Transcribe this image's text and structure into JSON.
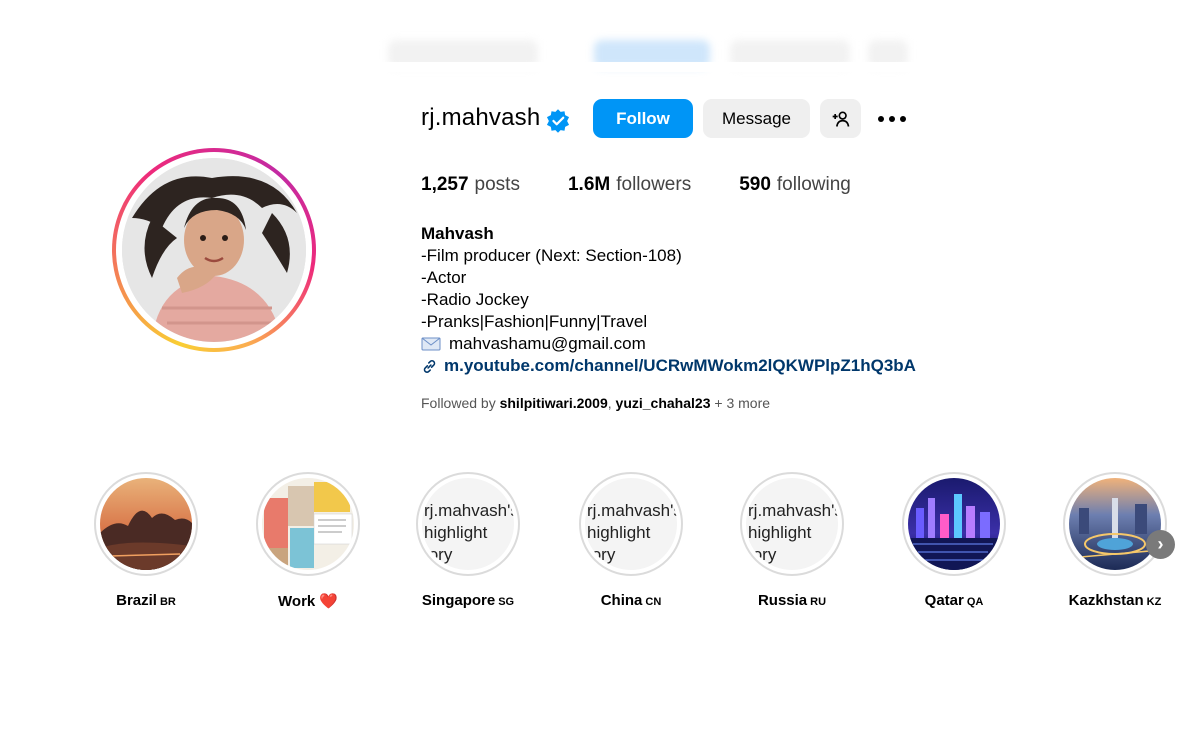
{
  "profile": {
    "username": "rj.mahvash",
    "verified": true,
    "follow_label": "Follow",
    "message_label": "Message",
    "add_user_icon": "person-add-icon",
    "more_icon": "more-options-icon",
    "avatar_icon": "profile-photo"
  },
  "stats": {
    "posts_count": "1,257",
    "posts_label": "posts",
    "followers_count": "1.6M",
    "followers_label": "followers",
    "following_count": "590",
    "following_label": "following"
  },
  "bio": {
    "name": "Mahvash",
    "lines": [
      "-Film producer (Next: Section-108)",
      "-Actor",
      "-Radio Jockey",
      "-Pranks|Fashion|Funny|Travel"
    ],
    "email": "mahvashamu@gmail.com",
    "link": "m.youtube.com/channel/UCRwMWokm2lQKWPlpZ1hQ3bA"
  },
  "followed_by": {
    "prefix": "Followed by",
    "user1": "shilpitiwari.2009",
    "separator": ",",
    "user2": "yuzi_chahal23",
    "suffix": "+ 3 more"
  },
  "highlights": [
    {
      "label": "Brazil",
      "flag": "BR",
      "cover": "image"
    },
    {
      "label": "Work",
      "flag": "❤️",
      "cover": "image"
    },
    {
      "label": "Singapore",
      "flag": "SG",
      "cover": "alt",
      "alt_text": [
        "rj.mahvash's",
        "highlight",
        "tory"
      ]
    },
    {
      "label": "China",
      "flag": "CN",
      "cover": "alt",
      "alt_text": [
        "rj.mahvash's",
        "highlight",
        "tory"
      ]
    },
    {
      "label": "Russia",
      "flag": "RU",
      "cover": "alt",
      "alt_text": [
        "rj.mahvash's",
        "highlight",
        "tory"
      ]
    },
    {
      "label": "Qatar",
      "flag": "QA",
      "cover": "image"
    },
    {
      "label": "Kazkhstan",
      "flag": "KZ",
      "cover": "image"
    }
  ],
  "next_icon": "chevron-right-icon",
  "colors": {
    "follow_button": "#0095f6",
    "secondary_button": "#efefef",
    "link": "#00376b"
  }
}
